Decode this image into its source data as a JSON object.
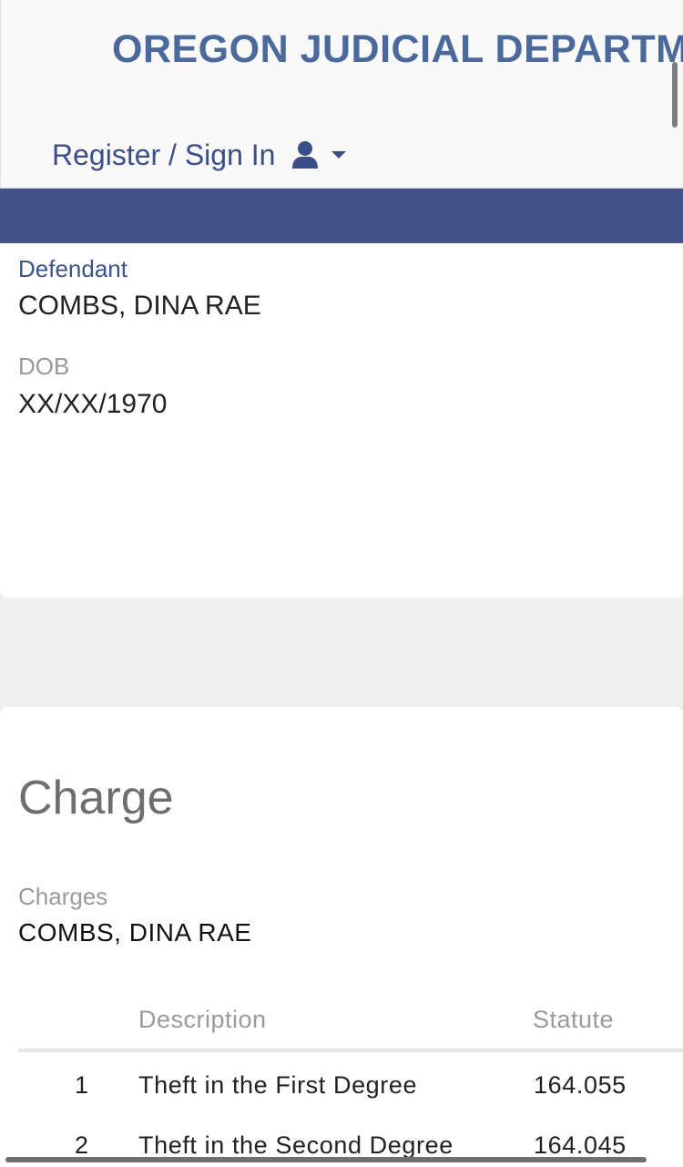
{
  "header": {
    "site_title": "OREGON JUDICIAL DEPARTMENT",
    "signin_label": "Register / Sign In",
    "user_icon": "user-icon",
    "caret_icon": "caret-down-icon"
  },
  "party": {
    "role_label": "Defendant",
    "name": "COMBS, DINA RAE",
    "dob_label": "DOB",
    "dob_value": "XX/XX/1970"
  },
  "charge": {
    "heading": "Charge",
    "charges_label": "Charges",
    "charges_name": "COMBS, DINA RAE",
    "columns": {
      "description": "Description",
      "statute": "Statute"
    },
    "rows": [
      {
        "number": "1",
        "description": "Theft in the First Degree",
        "statute": "164.055"
      },
      {
        "number": "2",
        "description": "Theft in the Second Degree",
        "statute": "164.045"
      }
    ]
  },
  "colors": {
    "brand_blue": "#4b6a9b",
    "nav_band": "#44528a",
    "link_blue": "#3c4f86"
  }
}
